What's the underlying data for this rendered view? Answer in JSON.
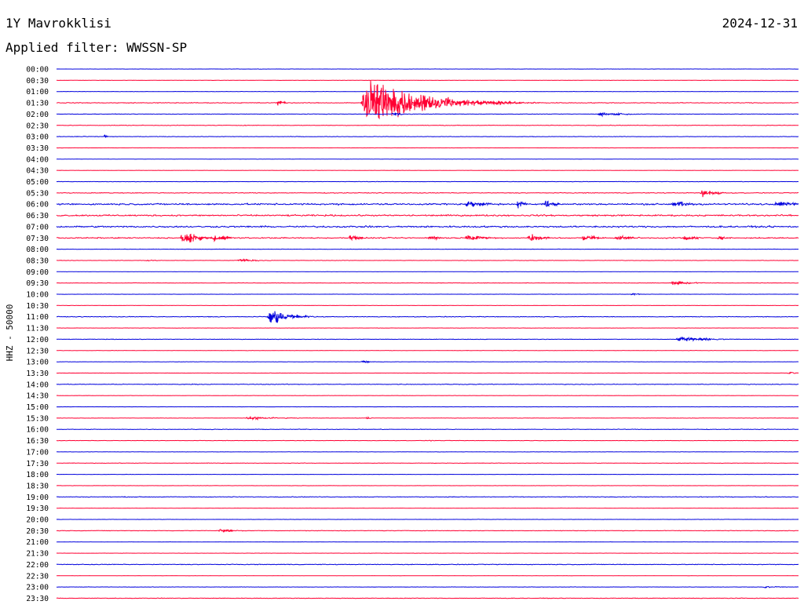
{
  "header": {
    "station": "1Y Mavrokklisi",
    "date": "2024-12-31",
    "filter": "Applied filter: WWSSN-SP"
  },
  "chart_data": {
    "type": "line",
    "ylabel": "HHZ - 50000",
    "row_minutes": 30,
    "row_labels": [
      "00:00",
      "00:30",
      "01:00",
      "01:30",
      "02:00",
      "02:30",
      "03:00",
      "03:30",
      "04:00",
      "04:30",
      "05:00",
      "05:30",
      "06:00",
      "06:30",
      "07:00",
      "07:30",
      "08:00",
      "08:30",
      "09:00",
      "09:30",
      "10:00",
      "10:30",
      "11:00",
      "11:30",
      "12:00",
      "12:30",
      "13:00",
      "13:30",
      "14:00",
      "14:30",
      "15:00",
      "15:30",
      "16:00",
      "16:30",
      "17:00",
      "17:30",
      "18:00",
      "18:30",
      "19:00",
      "19:30",
      "20:00",
      "20:30",
      "21:00",
      "21:30",
      "22:00",
      "22:30",
      "23:00",
      "23:30"
    ],
    "colors": {
      "even": "#0000dd",
      "odd": "#ff0033"
    },
    "row_noise": [
      0.2,
      0.2,
      0.3,
      0.6,
      0.4,
      0.5,
      0.4,
      0.2,
      0.2,
      0.2,
      0.3,
      0.6,
      1.4,
      1.3,
      1.4,
      1.0,
      0.3,
      0.3,
      0.2,
      0.4,
      0.2,
      0.2,
      0.6,
      0.2,
      0.4,
      0.3,
      0.2,
      0.2,
      0.6,
      0.2,
      0.2,
      0.3,
      0.5,
      0.3,
      0.2,
      0.4,
      0.2,
      0.2,
      0.6,
      0.2,
      0.2,
      0.5,
      0.2,
      0.2,
      0.6,
      0.2,
      0.3,
      0.5
    ],
    "events": [
      {
        "row": 3,
        "start_min": 8.9,
        "dur_min": 0.6,
        "amp": 8
      },
      {
        "row": 3,
        "start_min": 12.3,
        "dur_min": 5.0,
        "amp": 65
      },
      {
        "row": 3,
        "start_min": 18.5,
        "dur_min": 0.8,
        "amp": 3
      },
      {
        "row": 3,
        "start_min": 37.2,
        "dur_min": 2.5,
        "amp": 18
      },
      {
        "row": 3,
        "start_min": 46.2,
        "dur_min": 0.4,
        "amp": 5
      },
      {
        "row": 4,
        "start_min": 13.5,
        "dur_min": 1.5,
        "amp": 3
      },
      {
        "row": 4,
        "start_min": 21.8,
        "dur_min": 2.8,
        "amp": 4
      },
      {
        "row": 5,
        "start_min": 46.8,
        "dur_min": 1.2,
        "amp": 3
      },
      {
        "row": 6,
        "start_min": 0.5,
        "dur_min": 1.5,
        "amp": 2
      },
      {
        "row": 6,
        "start_min": 1.9,
        "dur_min": 0.3,
        "amp": 7
      },
      {
        "row": 7,
        "start_min": 37.0,
        "dur_min": 1.4,
        "amp": 2
      },
      {
        "row": 11,
        "start_min": 26.0,
        "dur_min": 1.4,
        "amp": 10
      },
      {
        "row": 11,
        "start_min": 30.0,
        "dur_min": 3.0,
        "amp": 9
      },
      {
        "row": 11,
        "start_min": 35.1,
        "dur_min": 1.4,
        "amp": 6
      },
      {
        "row": 11,
        "start_min": 36.5,
        "dur_min": 6.5,
        "amp": 9
      },
      {
        "row": 11,
        "start_min": 42.2,
        "dur_min": 2.0,
        "amp": 12
      },
      {
        "row": 11,
        "start_min": 47.3,
        "dur_min": 1.4,
        "amp": 8
      },
      {
        "row": 11,
        "start_min": 49.7,
        "dur_min": 1.4,
        "amp": 9
      },
      {
        "row": 12,
        "start_min": 16.5,
        "dur_min": 2.0,
        "amp": 7
      },
      {
        "row": 12,
        "start_min": 18.6,
        "dur_min": 0.6,
        "amp": 12
      },
      {
        "row": 12,
        "start_min": 19.7,
        "dur_min": 1.0,
        "amp": 10
      },
      {
        "row": 12,
        "start_min": 24.8,
        "dur_min": 1.8,
        "amp": 7
      },
      {
        "row": 12,
        "start_min": 29.0,
        "dur_min": 2.0,
        "amp": 6
      },
      {
        "row": 12,
        "start_min": 33.2,
        "dur_min": 1.3,
        "amp": 10
      },
      {
        "row": 12,
        "start_min": 36.7,
        "dur_min": 3.0,
        "amp": 12
      },
      {
        "row": 12,
        "start_min": 41.2,
        "dur_min": 1.3,
        "amp": 10
      },
      {
        "row": 12,
        "start_min": 47.0,
        "dur_min": 1.2,
        "amp": 8
      },
      {
        "row": 12,
        "start_min": 49.5,
        "dur_min": 1.5,
        "amp": 7
      },
      {
        "row": 12,
        "start_min": 51.4,
        "dur_min": 2.2,
        "amp": 9
      },
      {
        "row": 13,
        "start_min": 32.3,
        "dur_min": 2.3,
        "amp": 8
      },
      {
        "row": 13,
        "start_min": 37.8,
        "dur_min": 2.2,
        "amp": 7
      },
      {
        "row": 13,
        "start_min": 40.1,
        "dur_min": 3.0,
        "amp": 6
      },
      {
        "row": 13,
        "start_min": 42.6,
        "dur_min": 1.5,
        "amp": 7
      },
      {
        "row": 13,
        "start_min": 45.4,
        "dur_min": 3.5,
        "amp": 9
      },
      {
        "row": 13,
        "start_min": 49.5,
        "dur_min": 1.5,
        "amp": 7
      },
      {
        "row": 14,
        "start_min": 46.7,
        "dur_min": 2.5,
        "amp": 7
      },
      {
        "row": 14,
        "start_min": 49.2,
        "dur_min": 1.3,
        "amp": 6
      },
      {
        "row": 15,
        "start_min": 5.0,
        "dur_min": 1.6,
        "amp": 16
      },
      {
        "row": 15,
        "start_min": 6.3,
        "dur_min": 1.2,
        "amp": 10
      },
      {
        "row": 15,
        "start_min": 11.8,
        "dur_min": 1.0,
        "amp": 8
      },
      {
        "row": 15,
        "start_min": 15.0,
        "dur_min": 1.5,
        "amp": 5
      },
      {
        "row": 15,
        "start_min": 16.5,
        "dur_min": 2.0,
        "amp": 7
      },
      {
        "row": 15,
        "start_min": 19.0,
        "dur_min": 1.5,
        "amp": 9
      },
      {
        "row": 15,
        "start_min": 21.2,
        "dur_min": 1.5,
        "amp": 7
      },
      {
        "row": 15,
        "start_min": 22.5,
        "dur_min": 2.5,
        "amp": 4
      },
      {
        "row": 15,
        "start_min": 25.3,
        "dur_min": 1.2,
        "amp": 7
      },
      {
        "row": 15,
        "start_min": 26.7,
        "dur_min": 1.0,
        "amp": 4
      },
      {
        "row": 17,
        "start_min": 3.6,
        "dur_min": 1.2,
        "amp": 2
      },
      {
        "row": 17,
        "start_min": 7.2,
        "dur_min": 2.3,
        "amp": 3
      },
      {
        "row": 19,
        "start_min": 24.8,
        "dur_min": 2.0,
        "amp": 5
      },
      {
        "row": 19,
        "start_min": 42.2,
        "dur_min": 1.6,
        "amp": 3
      },
      {
        "row": 20,
        "start_min": 23.2,
        "dur_min": 0.8,
        "amp": 3
      },
      {
        "row": 22,
        "start_min": 8.5,
        "dur_min": 2.0,
        "amp": 16
      },
      {
        "row": 22,
        "start_min": 46.5,
        "dur_min": 2.0,
        "amp": 9
      },
      {
        "row": 23,
        "start_min": 42.2,
        "dur_min": 1.4,
        "amp": 2
      },
      {
        "row": 24,
        "start_min": 25.0,
        "dur_min": 3.0,
        "amp": 6
      },
      {
        "row": 25,
        "start_min": 30.8,
        "dur_min": 1.2,
        "amp": 3
      },
      {
        "row": 26,
        "start_min": 12.3,
        "dur_min": 1.0,
        "amp": 4
      },
      {
        "row": 26,
        "start_min": 42.2,
        "dur_min": 0.9,
        "amp": 2
      },
      {
        "row": 27,
        "start_min": 29.5,
        "dur_min": 2.0,
        "amp": 2
      },
      {
        "row": 28,
        "start_min": 43.1,
        "dur_min": 1.6,
        "amp": 5
      },
      {
        "row": 31,
        "start_min": 7.5,
        "dur_min": 4.0,
        "amp": 3
      },
      {
        "row": 31,
        "start_min": 12.5,
        "dur_min": 0.4,
        "amp": 4
      },
      {
        "row": 33,
        "start_min": 15.0,
        "dur_min": 0.6,
        "amp": 2
      },
      {
        "row": 41,
        "start_min": 6.5,
        "dur_min": 1.8,
        "amp": 4
      },
      {
        "row": 46,
        "start_min": 28.5,
        "dur_min": 2.2,
        "amp": 2
      }
    ]
  }
}
